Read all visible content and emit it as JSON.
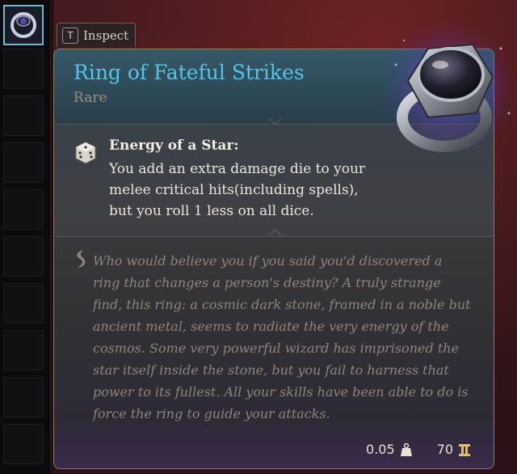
{
  "inspect": {
    "key": "T",
    "label": "Inspect"
  },
  "item": {
    "name": "Ring of Fateful Strikes",
    "rarity": "Rare"
  },
  "passive": {
    "name": "Energy of a Star:",
    "description": "You add an extra damage die to your melee critical hits(including spells), but you roll 1 less on all dice."
  },
  "flavor_text": "Who would believe you if you said you'd discovered a ring that changes a person's destiny? A truly strange find, this ring: a cosmic dark stone, framed in a noble but ancient metal, seems to radiate the very energy of the cosmos. Some very powerful wizard has imprisoned the star itself inside the stone, but you fail to harness that power to its fullest. All your skills have been able to do is force the ring to guide your attacks.",
  "footer": {
    "weight": "0.05",
    "value": "70"
  },
  "colors": {
    "title": "#56c3e8",
    "rarity": "#9a8f82",
    "selected_slot": "#6fb7d6"
  },
  "icons": [
    "ring-icon",
    "dice-icon",
    "quill-icon",
    "weight-icon",
    "gold-icon"
  ]
}
